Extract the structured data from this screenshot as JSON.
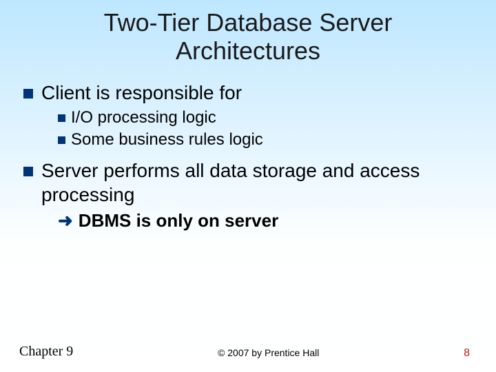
{
  "title": "Two-Tier Database Server Architectures",
  "bullets": {
    "b1": "Client is responsible for",
    "b1a": "I/O processing logic",
    "b1b": "Some business rules logic",
    "b2": "Server performs all data storage and access processing",
    "arrow_text": "DBMS is only on server"
  },
  "footer": {
    "chapter": "Chapter 9",
    "copyright": "© 2007 by Prentice Hall",
    "page": "8"
  }
}
